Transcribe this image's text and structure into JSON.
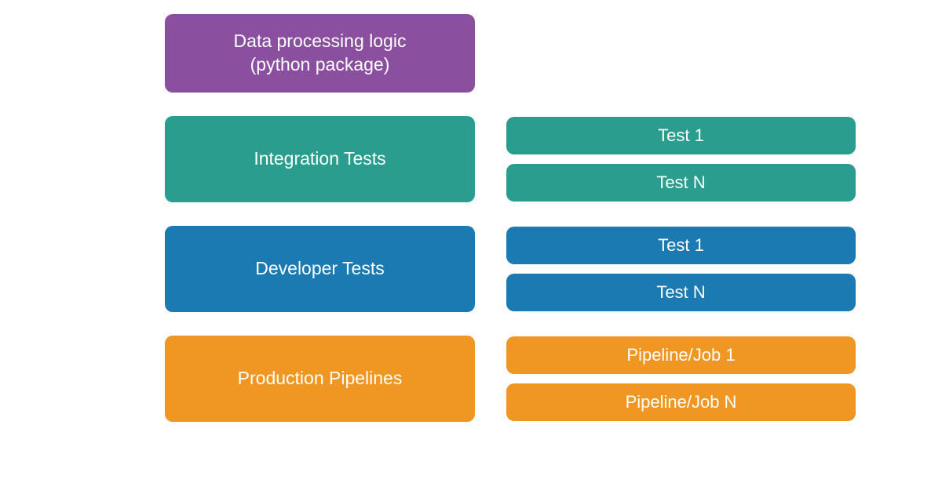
{
  "colors": {
    "purple": "#8b4f9f",
    "teal": "#2a9d8f",
    "blue": "#1c7ab2",
    "orange": "#ef9623"
  },
  "rows": [
    {
      "main": {
        "label": "Data processing logic\n(python package)",
        "color": "purple",
        "height": "short"
      },
      "items": []
    },
    {
      "main": {
        "label": "Integration Tests",
        "color": "teal",
        "height": "tall"
      },
      "items": [
        {
          "label": "Test 1",
          "color": "teal"
        },
        {
          "label": "Test N",
          "color": "teal"
        }
      ]
    },
    {
      "main": {
        "label": "Developer Tests",
        "color": "blue",
        "height": "tall"
      },
      "items": [
        {
          "label": "Test 1",
          "color": "blue"
        },
        {
          "label": "Test N",
          "color": "blue"
        }
      ]
    },
    {
      "main": {
        "label": "Production Pipelines",
        "color": "orange",
        "height": "tall"
      },
      "items": [
        {
          "label": "Pipeline/Job 1",
          "color": "orange"
        },
        {
          "label": "Pipeline/Job N",
          "color": "orange"
        }
      ]
    }
  ]
}
